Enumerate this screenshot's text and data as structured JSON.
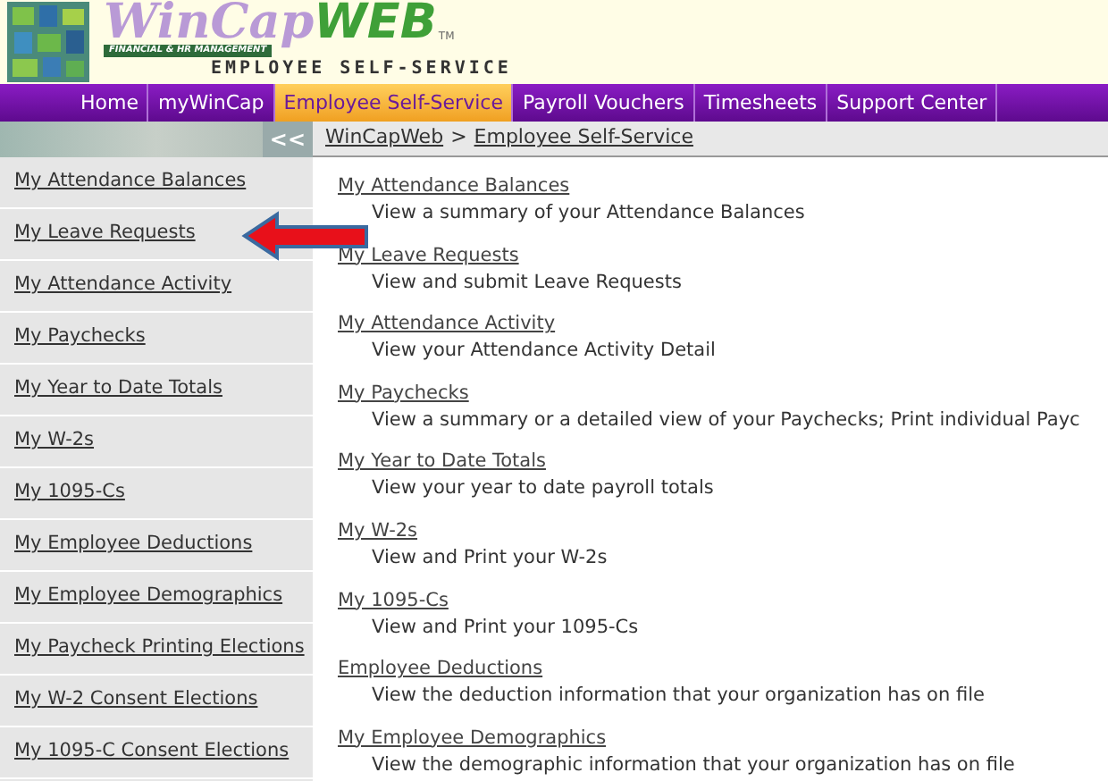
{
  "logo": {
    "wordmark": "WinCap",
    "wordmark_accent": "WEB",
    "trademark": "TM",
    "tagline": "FINANCIAL & HR MANAGEMENT",
    "subtitle": "EMPLOYEE SELF-SERVICE"
  },
  "nav": [
    {
      "label": "Home",
      "selected": false
    },
    {
      "label": "myWinCap",
      "selected": false
    },
    {
      "label": "Employee Self-Service",
      "selected": true
    },
    {
      "label": "Payroll Vouchers",
      "selected": false
    },
    {
      "label": "Timesheets",
      "selected": false
    },
    {
      "label": "Support Center",
      "selected": false
    }
  ],
  "collapse_button": "<<",
  "breadcrumb": [
    {
      "label": "WinCapWeb"
    },
    {
      "label": "Employee Self-Service"
    }
  ],
  "breadcrumb_separator": ">",
  "sidebar": {
    "items": [
      "My Attendance Balances",
      "My Leave Requests",
      "My Attendance Activity",
      "My Paychecks",
      "My Year to Date Totals",
      "My W-2s",
      "My 1095-Cs",
      "My Employee Deductions",
      "My Employee Demographics",
      "My Paycheck Printing Elections",
      "My W-2 Consent Elections",
      "My 1095-C Consent Elections"
    ]
  },
  "content": [
    {
      "title": "My Attendance Balances",
      "description": "View a summary of your Attendance Balances"
    },
    {
      "title": "My Leave Requests",
      "description": "View and submit Leave Requests"
    },
    {
      "title": "My Attendance Activity",
      "description": "View your Attendance Activity Detail"
    },
    {
      "title": "My Paychecks",
      "description": "View a summary or a detailed view of your Paychecks; Print individual Payc"
    },
    {
      "title": "My Year to Date Totals",
      "description": "View your year to date payroll totals"
    },
    {
      "title": "My W-2s",
      "description": "View and Print your W-2s"
    },
    {
      "title": "My 1095-Cs",
      "description": "View and Print your 1095-Cs"
    },
    {
      "title": "Employee Deductions",
      "description": "View the deduction information that your organization has on file"
    },
    {
      "title": "My Employee Demographics",
      "description": "View the demographic information that your organization has on file"
    }
  ]
}
